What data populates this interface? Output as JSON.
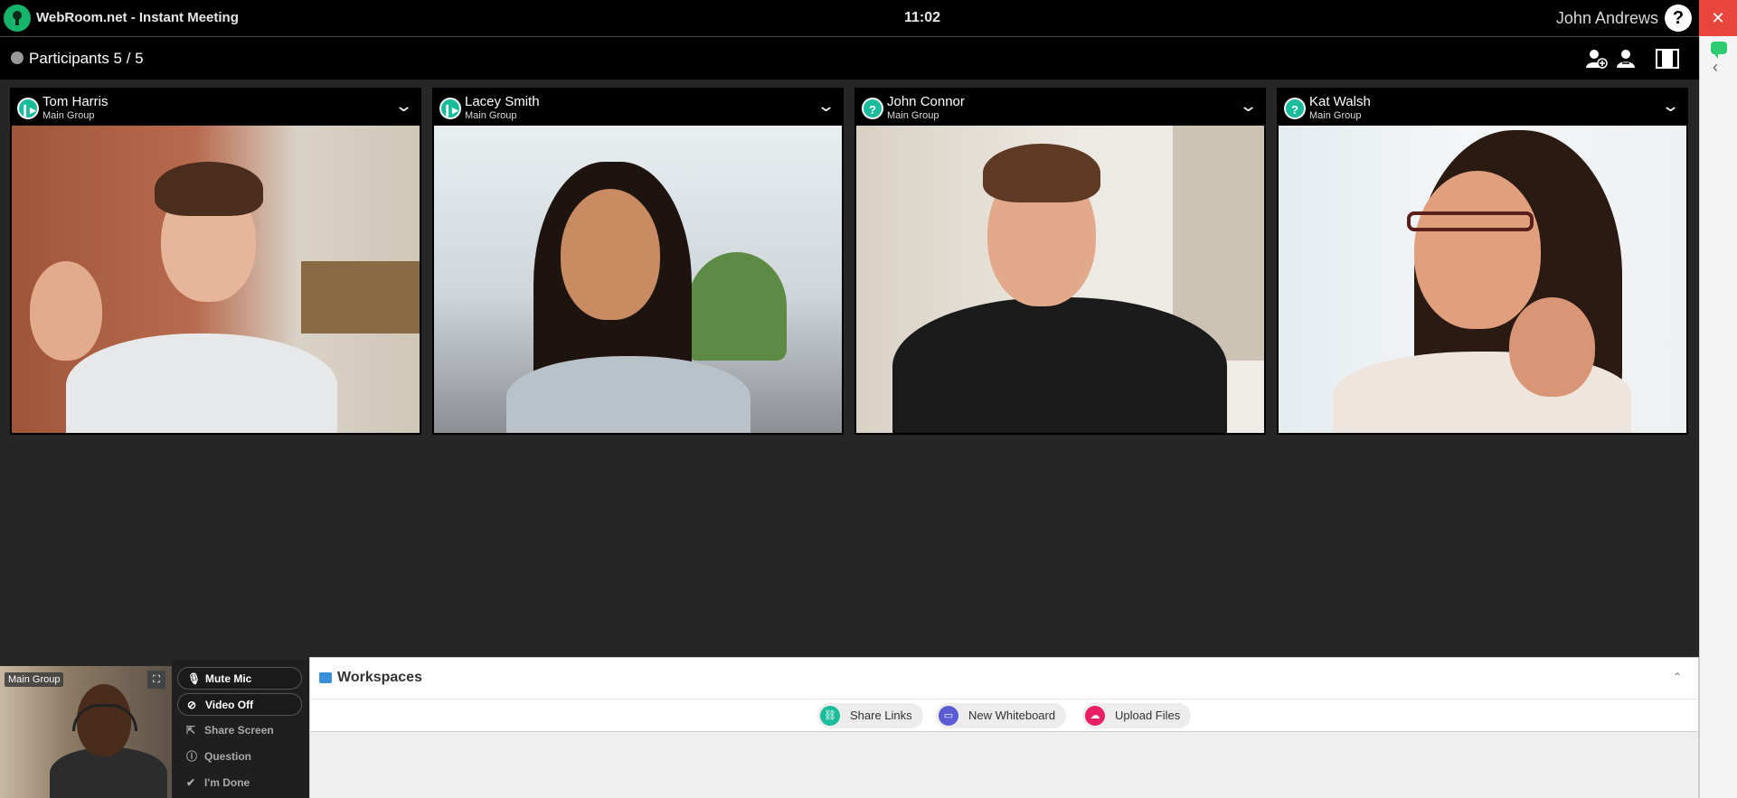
{
  "app": {
    "title": "WebRoom.net - Instant Meeting",
    "clock": "11:02",
    "user_name": "John Andrews",
    "help_label": "?",
    "close_label": "✕"
  },
  "participants": {
    "title": "Participants 5 / 5",
    "icons": [
      "add-participant-icon",
      "participants-icon",
      "layout-icon"
    ]
  },
  "tiles": [
    {
      "name": "Tom Harris",
      "group": "Main Group",
      "status": "speaking",
      "status_glyph": "❙▸"
    },
    {
      "name": "Lacey Smith",
      "group": "Main Group",
      "status": "speaking",
      "status_glyph": "❙▸"
    },
    {
      "name": "John Connor",
      "group": "Main Group",
      "status": "question",
      "status_glyph": "?"
    },
    {
      "name": "Kat Walsh",
      "group": "Main Group",
      "status": "question",
      "status_glyph": "?"
    }
  ],
  "self_view": {
    "badge": "Main Group"
  },
  "controls": {
    "mute_mic": "Mute Mic",
    "video_off": "Video Off",
    "share_screen": "Share Screen",
    "question": "Question",
    "im_done": "I'm Done"
  },
  "workspaces": {
    "title": "Workspaces",
    "buttons": [
      {
        "label": "Share Links",
        "color": "#1abc9c"
      },
      {
        "label": "New Whiteboard",
        "color": "#5b5bd6"
      },
      {
        "label": "Upload Files",
        "color": "#e91e63"
      }
    ]
  },
  "colors": {
    "accent_green": "#16b36b",
    "close_red": "#e8463c",
    "status_teal": "#1abc9c"
  }
}
